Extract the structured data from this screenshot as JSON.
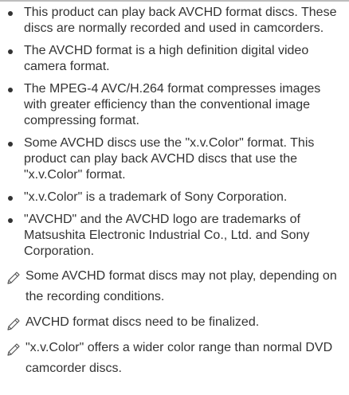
{
  "bullets": [
    {
      "text": "This product can play back AVCHD format discs. These discs are normally recorded and used in camcorders."
    },
    {
      "text": "The AVCHD format is a high definition digital video camera format."
    },
    {
      "text": "The MPEG-4 AVC/H.264 format compresses images with greater efficiency than the conventional image compressing format."
    },
    {
      "text": "Some AVCHD discs use the \"x.v.Color\" format. This product can play back AVCHD discs that use the \"x.v.Color\" format."
    },
    {
      "text": "\"x.v.Color\" is a trademark of Sony Corporation."
    },
    {
      "text": "\"AVCHD\" and the AVCHD logo are trademarks of Matsushita Electronic Industrial Co., Ltd. and Sony Corporation."
    }
  ],
  "notes": [
    {
      "icon": "pencil-note-icon",
      "text": "Some AVCHD format discs may not play, depending on the recording conditions."
    },
    {
      "icon": "pencil-note-icon",
      "text": "AVCHD format discs need to be finalized."
    },
    {
      "icon": "pencil-note-icon",
      "text": "\"x.v.Color\" offers a wider color range than normal DVD camcorder discs."
    }
  ],
  "colors": {
    "text": "#333333",
    "rule": "#bdbdbd",
    "icon": "#555555"
  }
}
